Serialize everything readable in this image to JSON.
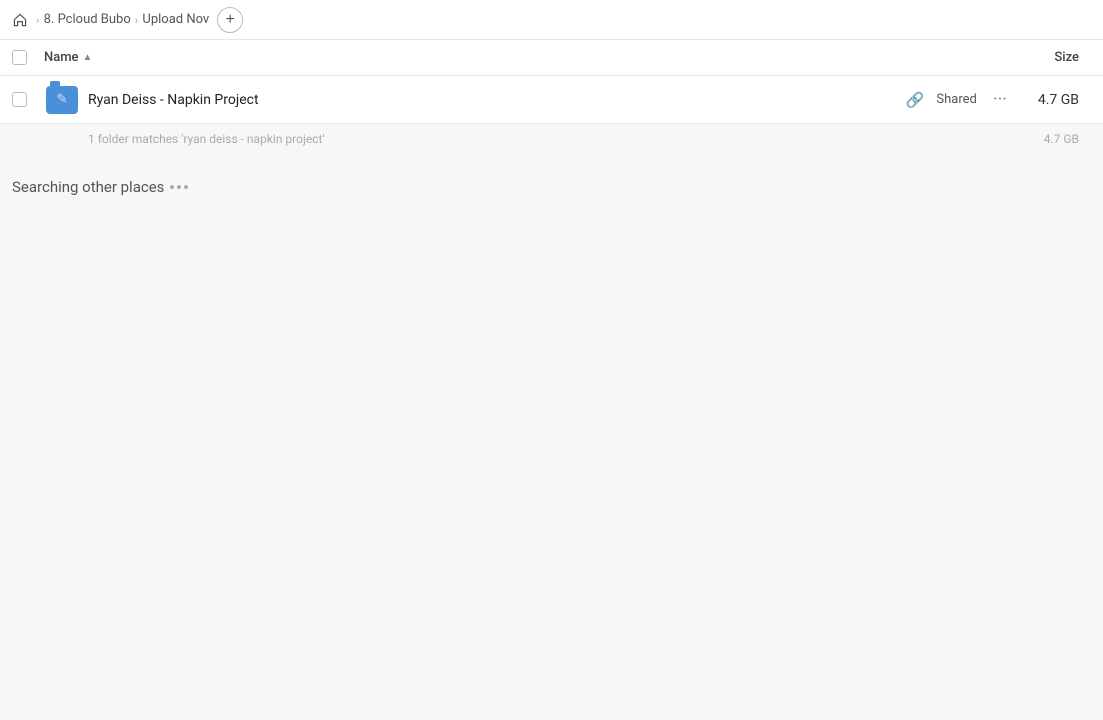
{
  "header": {
    "home_icon": "home",
    "breadcrumb": [
      {
        "id": "pcloud-bubo",
        "label": "8. Pcloud Bubo"
      },
      {
        "id": "upload-nov",
        "label": "Upload Nov"
      }
    ],
    "add_button_label": "+"
  },
  "columns": {
    "name_label": "Name",
    "size_label": "Size"
  },
  "file_row": {
    "name": "Ryan Deiss - Napkin Project",
    "shared_label": "Shared",
    "size": "4.7 GB",
    "icon_type": "folder"
  },
  "match_info": {
    "text": "1 folder matches 'ryan deiss - napkin project'",
    "size": "4.7 GB"
  },
  "searching": {
    "label": "Searching other places"
  }
}
